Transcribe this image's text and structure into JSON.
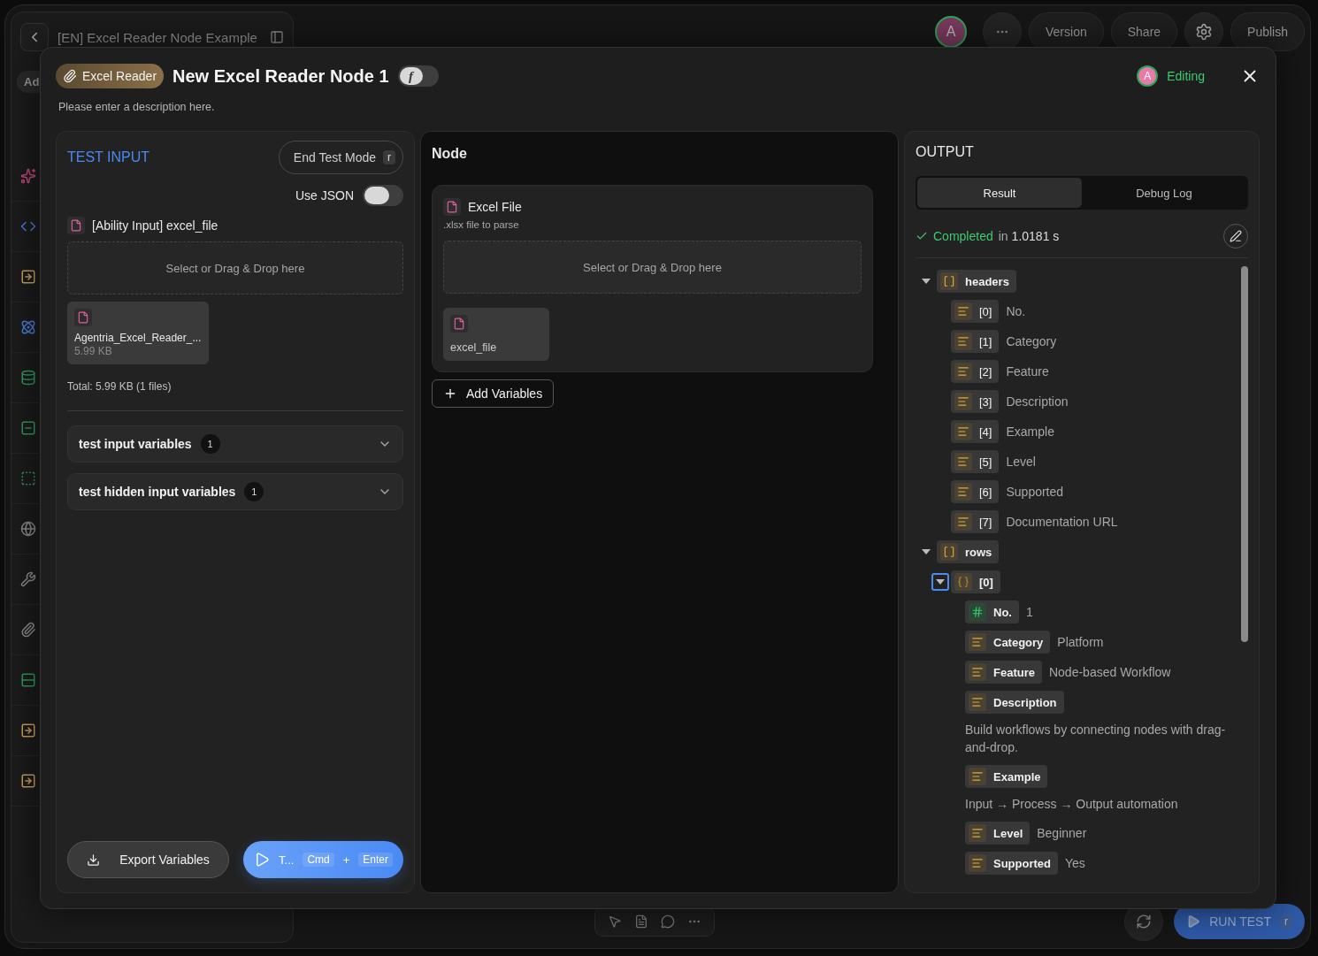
{
  "app": {
    "title": "[EN] Excel Reader Node Example",
    "sidebar": {
      "tab_label": "Ad",
      "icons": [
        {
          "kind": "sparkle"
        },
        {
          "kind": "code"
        },
        {
          "kind": "input"
        },
        {
          "kind": "atom"
        },
        {
          "kind": "database"
        },
        {
          "kind": "square"
        },
        {
          "kind": "dashed"
        },
        {
          "kind": "globe"
        },
        {
          "kind": "tools"
        },
        {
          "kind": "clip"
        },
        {
          "kind": "rows"
        },
        {
          "kind": "input"
        },
        {
          "kind": "input"
        }
      ]
    },
    "avatar": "A",
    "actions": [
      "Version",
      "Share"
    ],
    "publish": "Publish",
    "canvas_tools": [
      {
        "kind": "pointer"
      },
      {
        "kind": "document"
      },
      {
        "kind": "chat"
      },
      {
        "kind": "more"
      }
    ],
    "run_test": {
      "label": "RUN TEST",
      "shortcut": "r"
    }
  },
  "modal": {
    "badge": "Excel Reader",
    "title": "New Excel Reader Node 1",
    "function_toggle": {
      "symbol": "f",
      "on": false
    },
    "editor": {
      "initial": "A",
      "status": "Editing"
    },
    "description": "Please enter a description here.",
    "test_input": {
      "title": "TEST INPUT",
      "end_button": {
        "label": "End Test Mode",
        "shortcut": "r"
      },
      "use_json": {
        "label": "Use JSON",
        "on": false
      },
      "field_label": "[Ability Input] excel_file",
      "dropzone": "Select or Drag & Drop here",
      "file": {
        "name": "Agentria_Excel_Reader_...",
        "size": "5.99 KB"
      },
      "total": "Total: 5.99 KB (1 files)",
      "sections": [
        {
          "label": "test input variables",
          "count": "1",
          "expanded": false
        },
        {
          "label": "test hidden input variables",
          "count": "1",
          "expanded": false
        }
      ],
      "export_button": "Export Variables",
      "run_button": {
        "label": "T...",
        "keys": [
          "Cmd",
          "Enter"
        ],
        "joiner": "+"
      }
    },
    "node": {
      "title": "Node",
      "field": {
        "label": "Excel File",
        "hint": ".xlsx file to parse",
        "dropzone": "Select or Drag & Drop here",
        "chip": "excel_file"
      },
      "add_button": "Add Variables"
    },
    "output": {
      "title": "OUTPUT",
      "tabs": [
        {
          "label": "Result",
          "selected": true
        },
        {
          "label": "Debug Log",
          "selected": false
        }
      ],
      "status": {
        "state": "Completed",
        "joiner": "in",
        "time": "1.0181 s"
      },
      "tree": [
        {
          "key": "headers",
          "kind": "array",
          "expanded": true,
          "focused": false,
          "children": [
            {
              "key": "[0]",
              "kind": "string",
              "value": "No.",
              "value_below": false
            },
            {
              "key": "[1]",
              "kind": "string",
              "value": "Category",
              "value_below": false
            },
            {
              "key": "[2]",
              "kind": "string",
              "value": "Feature",
              "value_below": false
            },
            {
              "key": "[3]",
              "kind": "string",
              "value": "Description",
              "value_below": false
            },
            {
              "key": "[4]",
              "kind": "string",
              "value": "Example",
              "value_below": false
            },
            {
              "key": "[5]",
              "kind": "string",
              "value": "Level",
              "value_below": false
            },
            {
              "key": "[6]",
              "kind": "string",
              "value": "Supported",
              "value_below": false
            },
            {
              "key": "[7]",
              "kind": "string",
              "value": "Documentation URL",
              "value_below": false
            }
          ]
        },
        {
          "key": "rows",
          "kind": "array",
          "expanded": true,
          "focused": false,
          "children": [
            {
              "key": "[0]",
              "kind": "object",
              "expanded": true,
              "focused": true,
              "children": [
                {
                  "key": "No.",
                  "kind": "number",
                  "value": "1",
                  "value_below": false
                },
                {
                  "key": "Category",
                  "kind": "string",
                  "value": "Platform",
                  "value_below": false
                },
                {
                  "key": "Feature",
                  "kind": "string",
                  "value": "Node-based Workflow",
                  "value_below": false
                },
                {
                  "key": "Description",
                  "kind": "string",
                  "value": "Build workflows by connecting nodes with drag-and-drop.",
                  "value_below": true
                },
                {
                  "key": "Example",
                  "kind": "string",
                  "value": "Input → Process → Output automation",
                  "value_below": true
                },
                {
                  "key": "Level",
                  "kind": "string",
                  "value": "Beginner",
                  "value_below": false
                },
                {
                  "key": "Supported",
                  "kind": "string",
                  "value": "Yes",
                  "value_below": false
                }
              ]
            }
          ]
        }
      ]
    }
  }
}
